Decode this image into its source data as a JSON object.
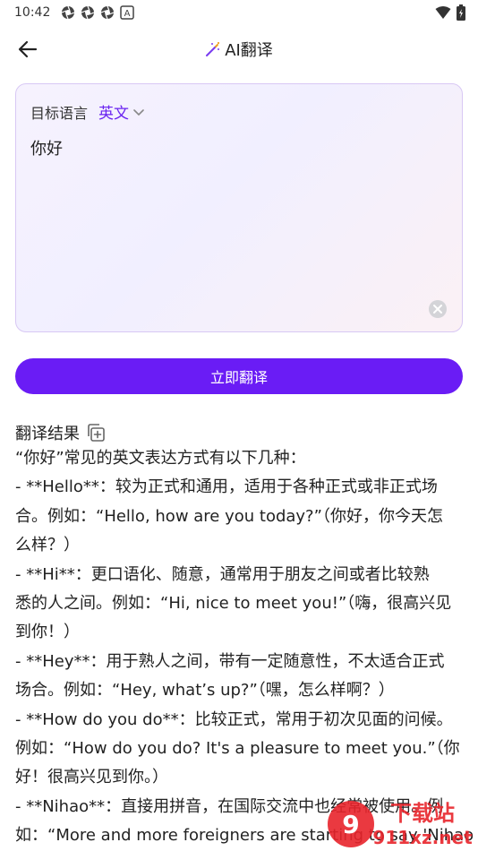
{
  "status_bar": {
    "time": "10:42",
    "notification_letter": "A"
  },
  "app_bar": {
    "title": "AI翻译"
  },
  "input": {
    "target_label": "目标语言",
    "target_language": "英文",
    "source_text": "你好"
  },
  "translate_button": "立即翻译",
  "result": {
    "header": "翻译结果",
    "lines": [
      "“你好”常见的英文表达方式有以下几种：",
      "- **Hello**：较为正式和通用，适用于各种正式或非正式场",
      "合。例如：“Hello, how are you today?”（你好，你今天怎",
      "么样？）",
      "- **Hi**：更口语化、随意，通常用于朋友之间或者比较熟",
      "悉的人之间。例如：“Hi, nice to meet you!”（嗨，很高兴见",
      "到你！）",
      "- **Hey**：用于熟人之间，带有一定随意性，不太适合正式",
      "场合。例如：“Hey, what’s up?”（嘿，怎么样啊？）",
      "- **How do you do**：比较正式，常用于初次见面的问候。",
      "例如：“How do you do? It's a pleasure to meet you.”（你",
      "好！很高兴见到你。）",
      "- **Nihao**：直接用拼音，在国际交流中也经常被使用。例",
      "如：“More and more foreigners are starting to say 'Nihao"
    ]
  },
  "watermark": {
    "text_main": "下载站",
    "text_domain": "911xz.net"
  },
  "colors": {
    "accent": "#6a1cf5",
    "accent_text": "#6a24f0",
    "card_border": "#d8c8f4",
    "watermark_red": "#e8242b"
  }
}
